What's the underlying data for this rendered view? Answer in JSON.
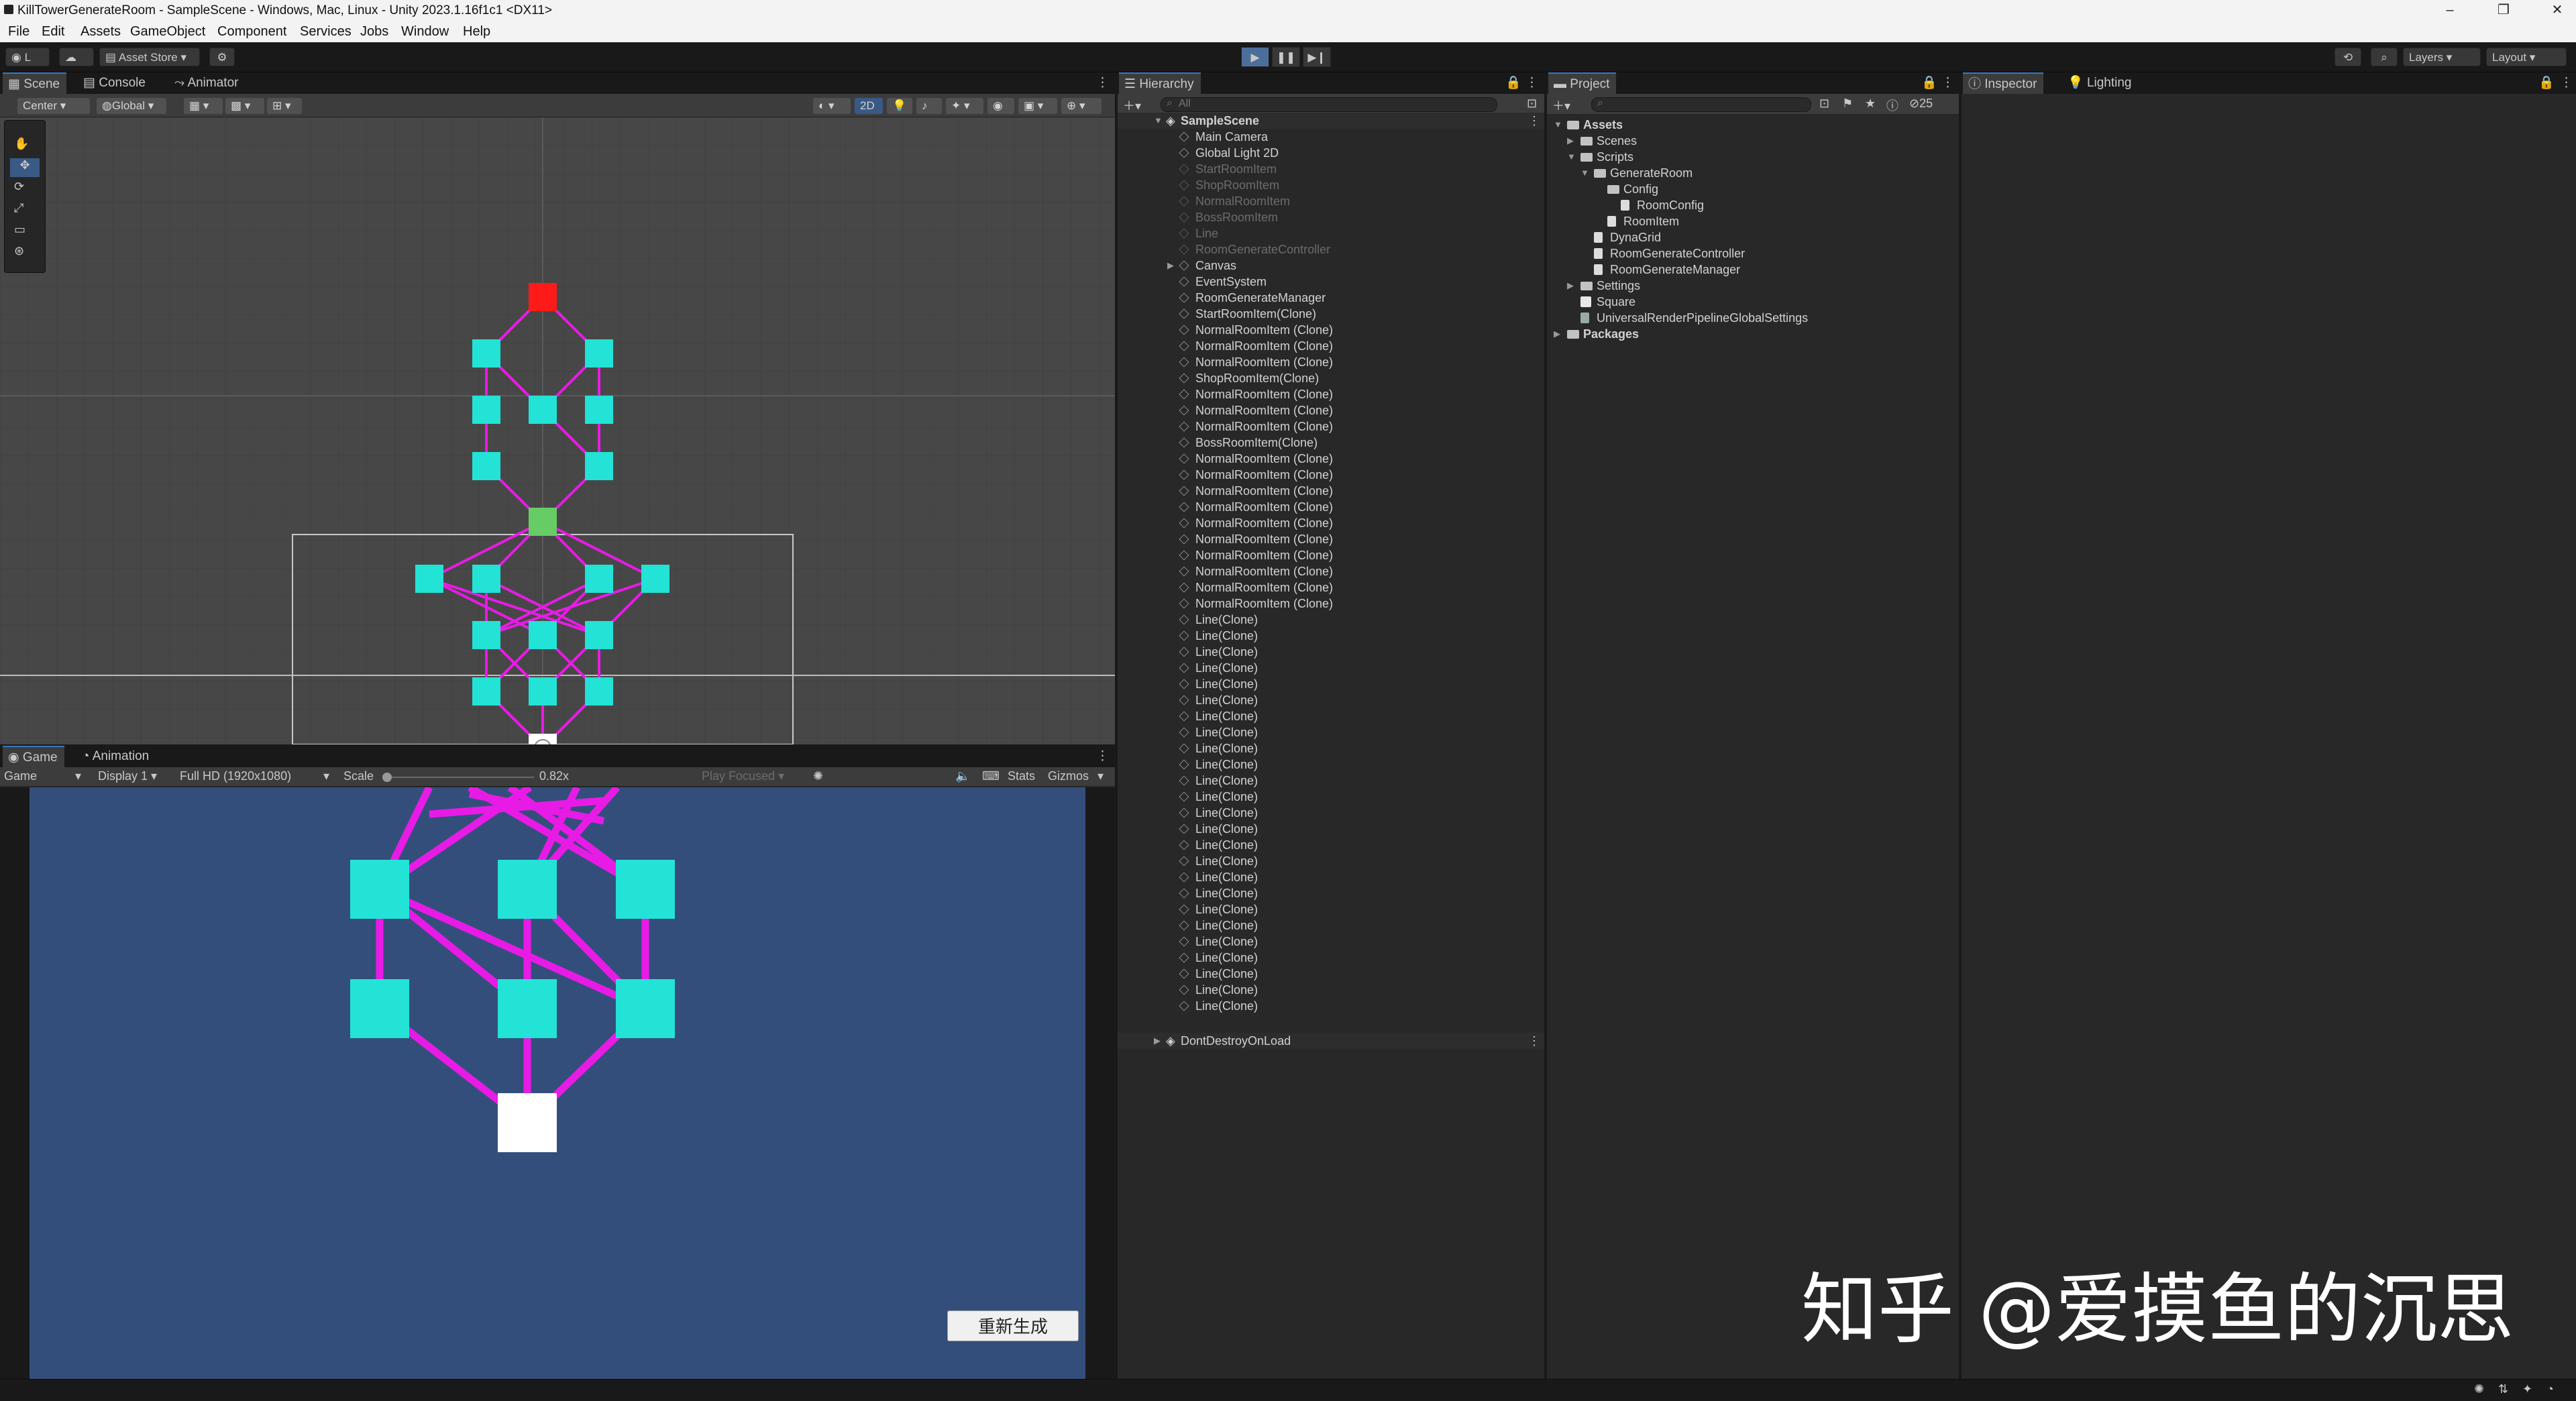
{
  "window": {
    "title": "KillTowerGenerateRoom - SampleScene - Windows, Mac, Linux - Unity 2023.1.16f1c1 <DX11>",
    "minimize_icon": "minimize-icon",
    "maximize_icon": "restore-icon",
    "close_icon": "close-icon",
    "min_glyph": "–",
    "max_glyph": "❐",
    "close_glyph": "✕"
  },
  "menu": [
    "File",
    "Edit",
    "Assets",
    "GameObject",
    "Component",
    "Services",
    "Jobs",
    "Window",
    "Help"
  ],
  "toolbar": {
    "account": "L",
    "asset_store": "Asset Store",
    "layers": "Layers",
    "layout": "Layout",
    "play_glyph": "▶",
    "pause_glyph": "❚❚",
    "step_glyph": "▶❙"
  },
  "scene_panel": {
    "tabs": [
      "Scene",
      "Console",
      "Animator"
    ],
    "pivot": "Center",
    "space": "Global",
    "mode_2d": "2D"
  },
  "game_panel": {
    "tabs": [
      "Game",
      "Animation"
    ],
    "mode": "Game",
    "display": "Display 1",
    "resolution": "Full HD (1920x1080)",
    "scale_label": "Scale",
    "scale_value": "0.82x",
    "play_focused": "Play Focused",
    "stats": "Stats",
    "gizmos": "Gizmos",
    "regenerate_button": "重新生成",
    "background_color": "#344e7c"
  },
  "hierarchy": {
    "tab": "Hierarchy",
    "search_placeholder": "All",
    "scene": "SampleScene",
    "items": [
      {
        "label": "Main Camera",
        "dim": false
      },
      {
        "label": "Global Light 2D",
        "dim": false
      },
      {
        "label": "StartRoomItem",
        "dim": true
      },
      {
        "label": "ShopRoomItem",
        "dim": true
      },
      {
        "label": "NormalRoomItem",
        "dim": true
      },
      {
        "label": "BossRoomItem",
        "dim": true
      },
      {
        "label": "Line",
        "dim": true
      },
      {
        "label": "RoomGenerateController",
        "dim": true
      },
      {
        "label": "Canvas",
        "dim": false
      },
      {
        "label": "EventSystem",
        "dim": false
      },
      {
        "label": "RoomGenerateManager",
        "dim": false
      },
      {
        "label": "StartRoomItem(Clone)",
        "dim": false
      },
      {
        "label": "NormalRoomItem (Clone)",
        "dim": false
      },
      {
        "label": "NormalRoomItem (Clone)",
        "dim": false
      },
      {
        "label": "NormalRoomItem (Clone)",
        "dim": false
      },
      {
        "label": "ShopRoomItem(Clone)",
        "dim": false
      },
      {
        "label": "NormalRoomItem (Clone)",
        "dim": false
      },
      {
        "label": "NormalRoomItem (Clone)",
        "dim": false
      },
      {
        "label": "NormalRoomItem (Clone)",
        "dim": false
      },
      {
        "label": "BossRoomItem(Clone)",
        "dim": false
      },
      {
        "label": "NormalRoomItem (Clone)",
        "dim": false
      },
      {
        "label": "NormalRoomItem (Clone)",
        "dim": false
      },
      {
        "label": "NormalRoomItem (Clone)",
        "dim": false
      },
      {
        "label": "NormalRoomItem (Clone)",
        "dim": false
      },
      {
        "label": "NormalRoomItem (Clone)",
        "dim": false
      },
      {
        "label": "NormalRoomItem (Clone)",
        "dim": false
      },
      {
        "label": "NormalRoomItem (Clone)",
        "dim": false
      },
      {
        "label": "NormalRoomItem (Clone)",
        "dim": false
      },
      {
        "label": "NormalRoomItem (Clone)",
        "dim": false
      },
      {
        "label": "NormalRoomItem (Clone)",
        "dim": false
      },
      {
        "label": "Line(Clone)",
        "dim": false
      },
      {
        "label": "Line(Clone)",
        "dim": false
      },
      {
        "label": "Line(Clone)",
        "dim": false
      },
      {
        "label": "Line(Clone)",
        "dim": false
      },
      {
        "label": "Line(Clone)",
        "dim": false
      },
      {
        "label": "Line(Clone)",
        "dim": false
      },
      {
        "label": "Line(Clone)",
        "dim": false
      },
      {
        "label": "Line(Clone)",
        "dim": false
      },
      {
        "label": "Line(Clone)",
        "dim": false
      },
      {
        "label": "Line(Clone)",
        "dim": false
      },
      {
        "label": "Line(Clone)",
        "dim": false
      },
      {
        "label": "Line(Clone)",
        "dim": false
      },
      {
        "label": "Line(Clone)",
        "dim": false
      },
      {
        "label": "Line(Clone)",
        "dim": false
      },
      {
        "label": "Line(Clone)",
        "dim": false
      },
      {
        "label": "Line(Clone)",
        "dim": false
      },
      {
        "label": "Line(Clone)",
        "dim": false
      },
      {
        "label": "Line(Clone)",
        "dim": false
      },
      {
        "label": "Line(Clone)",
        "dim": false
      },
      {
        "label": "Line(Clone)",
        "dim": false
      },
      {
        "label": "Line(Clone)",
        "dim": false
      },
      {
        "label": "Line(Clone)",
        "dim": false
      },
      {
        "label": "Line(Clone)",
        "dim": false
      },
      {
        "label": "Line(Clone)",
        "dim": false
      },
      {
        "label": "Line(Clone)",
        "dim": false
      }
    ],
    "dont_destroy": "DontDestroyOnLoad"
  },
  "project": {
    "tab": "Project",
    "hidden_count": "25",
    "tree": [
      {
        "label": "Assets",
        "type": "folder",
        "depth": 0,
        "bold": true
      },
      {
        "label": "Scenes",
        "type": "folder",
        "depth": 1
      },
      {
        "label": "Scripts",
        "type": "folder",
        "depth": 1
      },
      {
        "label": "GenerateRoom",
        "type": "folder",
        "depth": 2
      },
      {
        "label": "Config",
        "type": "folder",
        "depth": 3
      },
      {
        "label": "RoomConfig",
        "type": "script",
        "depth": 4
      },
      {
        "label": "RoomItem",
        "type": "script",
        "depth": 3
      },
      {
        "label": "DynaGrid",
        "type": "script",
        "depth": 2
      },
      {
        "label": "RoomGenerateController",
        "type": "script",
        "depth": 2
      },
      {
        "label": "RoomGenerateManager",
        "type": "script",
        "depth": 2
      },
      {
        "label": "Settings",
        "type": "folder",
        "depth": 1
      },
      {
        "label": "Square",
        "type": "sprite",
        "depth": 1
      },
      {
        "label": "UniversalRenderPipelineGlobalSettings",
        "type": "asset",
        "depth": 1
      },
      {
        "label": "Packages",
        "type": "folder",
        "depth": 0,
        "bold": true
      }
    ]
  },
  "inspector": {
    "tabs": [
      "Inspector",
      "Lighting"
    ]
  },
  "watermark": "知乎 @爱摸鱼的沉思",
  "colors": {
    "room_normal": "#22e3d6",
    "room_boss": "#ff1a1a",
    "room_shop": "#66cc66",
    "room_start": "#ffffff",
    "connection_line": "#e81be6",
    "accent": "#3a79bb"
  }
}
